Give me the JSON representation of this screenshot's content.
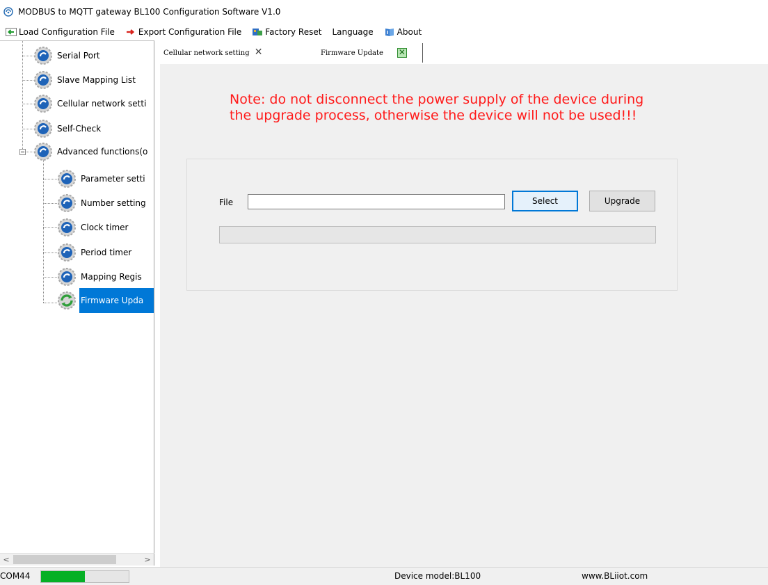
{
  "window": {
    "title": "MODBUS to MQTT gateway BL100 Configuration Software V1.0"
  },
  "menu": [
    {
      "label": "Load Configuration File",
      "icon": "arrow-left-icon"
    },
    {
      "label": "Export Configuration File",
      "icon": "arrow-right-icon"
    },
    {
      "label": "Factory Reset",
      "icon": "factory-reset-icon"
    },
    {
      "label": "Language",
      "icon": ""
    },
    {
      "label": "About",
      "icon": "about-icon"
    }
  ],
  "tree": {
    "items": [
      {
        "label": "Serial Port",
        "level": 0
      },
      {
        "label": "Slave Mapping List",
        "level": 0
      },
      {
        "label": "Cellular network setti",
        "level": 0
      },
      {
        "label": "Self-Check",
        "level": 0
      },
      {
        "label": "Advanced functions(o",
        "level": 0,
        "expanded": true
      },
      {
        "label": "Parameter setti",
        "level": 1
      },
      {
        "label": "Number setting",
        "level": 1
      },
      {
        "label": "Clock timer",
        "level": 1
      },
      {
        "label": "Period timer",
        "level": 1
      },
      {
        "label": "Mapping Regis",
        "level": 1
      },
      {
        "label": "Firmware Upda",
        "level": 1,
        "selected": true
      }
    ]
  },
  "tabs": [
    {
      "label": "Cellular network setting",
      "active": false
    },
    {
      "label": "Firmware Update",
      "active": true
    }
  ],
  "firmware": {
    "warning": "Note: do not disconnect the power supply of the device during the upgrade process, otherwise the device will not be used!!!",
    "file_label": "File",
    "file_value": "",
    "select_label": "Select",
    "upgrade_label": "Upgrade",
    "progress": 0
  },
  "status": {
    "port": "COM44",
    "connection_level": 0.5,
    "device_model": "Device model:BL100",
    "website": "www.BLiiot.com"
  },
  "colors": {
    "warning": "#ff1a1a",
    "selection": "#0078d7",
    "progress": "#06b025"
  }
}
